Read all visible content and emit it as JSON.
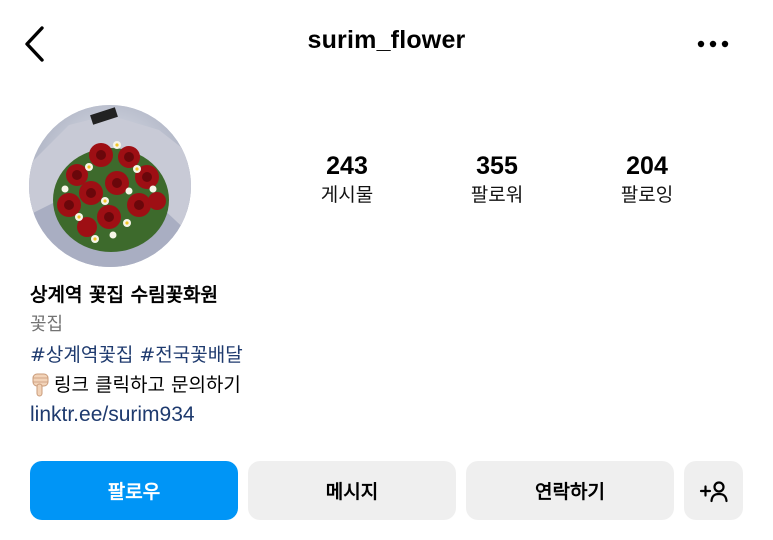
{
  "header": {
    "username": "surim_flower"
  },
  "profile": {
    "stats": [
      {
        "count": "243",
        "label": "게시물"
      },
      {
        "count": "355",
        "label": "팔로워"
      },
      {
        "count": "204",
        "label": "팔로잉"
      }
    ],
    "display_name": "상계역 꽃집 수림꽃화원",
    "category": "꽃집",
    "hashtags": [
      "#상계역꽃집",
      "#전국꽃배달"
    ],
    "bio_line": "링크 클릭하고 문의하기",
    "link": "linktr.ee/surim934"
  },
  "actions": {
    "follow": "팔로우",
    "message": "메시지",
    "contact": "연락하기"
  },
  "colors": {
    "accent": "#0095f6",
    "link": "#1e3a6e",
    "secondary_button": "#efefef"
  },
  "icons": {
    "back": "chevron-left-icon",
    "more": "more-horizontal-icon",
    "add_person": "add-person-icon",
    "pointer": "pointing-hand-icon"
  }
}
